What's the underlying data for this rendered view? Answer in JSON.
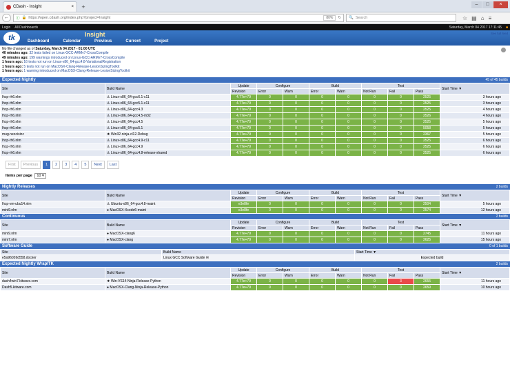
{
  "browser": {
    "tab_title": "CDash - Insight",
    "new_tab": "+",
    "url": "https://open.cdash.org/index.php?project=Insight",
    "zoom": "80%",
    "search_placeholder": "Search"
  },
  "topbar": {
    "login": "Login",
    "all": "All Dashboards",
    "date": "Saturday, March 04 2017 17:11:45"
  },
  "header": {
    "logo": "tk",
    "project": "Insight",
    "menu": [
      "Dashboard",
      "Calendar",
      "Previous",
      "Current",
      "Project"
    ]
  },
  "status": {
    "line0_prefix": "No file changed as of ",
    "line0_date": "Saturday, March 04 2017 - 01:00 UTC",
    "lines": [
      {
        "ago": "40 minutes ago:",
        "text": " 32 tests failed on Linux-GCC-ARMv7-CrossCompile"
      },
      {
        "ago": "49 minutes ago:",
        "text": " 199 warnings introduced on Linux-GCC-ARMv7-CrossCompile"
      },
      {
        "ago": "1 hours ago:",
        "text": " 16 tests not run on Linux-x86_64-gcc4.8-VariationalRegistration"
      },
      {
        "ago": "1 hours ago:",
        "text": " 5 tests not run on MacOSX-Clang-Release-LesionSizingToolkit"
      },
      {
        "ago": "1 hours ago:",
        "text": " 1 warning introduced on MacOSX-Clang-Release-LesionSizingToolkit"
      }
    ],
    "see_full": "See full feed"
  },
  "headers": {
    "site": "Site",
    "build": "Build Name",
    "update": "Update",
    "revision": "Revision",
    "configure": "Configure",
    "build_grp": "Build",
    "test": "Test",
    "error": "Error",
    "warn": "Warn",
    "notrun": "Not Run",
    "fail": "Fail",
    "pass": "Pass",
    "start": "Start Time ▼"
  },
  "expected": {
    "title": "Expected Nightly",
    "count": "45 of 45 builds",
    "rows": [
      {
        "site": "lhcp-rh6.nlm",
        "build": "Linux-x86_64-gcc6.1-c11",
        "rev": "4.77e+79",
        "ce": "0",
        "cw": "0",
        "be": "0",
        "bw": "0",
        "nr": "0",
        "f": "0",
        "p": "2525",
        "t": "3 hours ago"
      },
      {
        "site": "lhcp-rh6.nlm",
        "build": "Linux-x86_64-gcc5.1-c11",
        "rev": "4.77e+79",
        "ce": "0",
        "cw": "0",
        "be": "0",
        "bw": "0",
        "nr": "0",
        "f": "0",
        "p": "2525",
        "t": "3 hours ago"
      },
      {
        "site": "lhcp-rh6.nlm",
        "build": "Linux-x86_64-gcc4.3",
        "rev": "4.77e+79",
        "ce": "0",
        "cw": "0",
        "be": "0",
        "bw": "0",
        "nr": "0",
        "f": "0",
        "p": "2525",
        "t": "4 hours ago"
      },
      {
        "site": "lhcp-rh6.nlm",
        "build": "Linux-x86_64-gcc4.5-m32",
        "rev": "4.77e+79",
        "ce": "0",
        "cw": "0",
        "be": "0",
        "bw": "0",
        "nr": "0",
        "f": "0",
        "p": "2526",
        "t": "4 hours ago"
      },
      {
        "site": "lhcp-rh6.nlm",
        "build": "Linux-x86_64-gcc4.5",
        "rev": "4.77e+79",
        "ce": "0",
        "cw": "0",
        "be": "0",
        "bw": "0",
        "nr": "0",
        "f": "0",
        "p": "2525",
        "t": "5 hours ago"
      },
      {
        "site": "lhcp-rh6.nlm",
        "build": "Linux-x86_64-gcc5.1",
        "rev": "4.77e+79",
        "ce": "0",
        "cw": "0",
        "be": "0",
        "bw": "0",
        "nr": "0",
        "f": "0",
        "p": "5058",
        "t": "5 hours ago"
      },
      {
        "site": "mug.neocisinc",
        "build": "Win32-ninja-cl12-Debug",
        "rev": "4.77e+79",
        "ce": "0",
        "cw": "0",
        "be": "0",
        "bw": "0",
        "nr": "0",
        "f": "0",
        "p": "2367",
        "t": "5 hours ago"
      },
      {
        "site": "lhcp-rh6.nlm",
        "build": "Linux-x86_64-gcc4.9-c11",
        "rev": "4.77e+79",
        "ce": "0",
        "cw": "0",
        "be": "0",
        "bw": "0",
        "nr": "0",
        "f": "0",
        "p": "2525",
        "t": "6 hours ago"
      },
      {
        "site": "lhcp-rh6.nlm",
        "build": "Linux-x86_64-gcc4.9",
        "rev": "4.77e+79",
        "ce": "0",
        "cw": "0",
        "be": "0",
        "bw": "0",
        "nr": "0",
        "f": "0",
        "p": "2525",
        "t": "6 hours ago"
      },
      {
        "site": "lhcp-rh6.nlm",
        "build": "Linux-x86_64-gcc4.8-release-shared",
        "rev": "4.77e+79",
        "ce": "0",
        "cw": "0",
        "be": "0",
        "bw": "0",
        "nr": "0",
        "f": "0",
        "p": "2525",
        "t": "6 hours ago"
      }
    ]
  },
  "pager": {
    "first": "First",
    "prev": "Previous",
    "pages": [
      "1",
      "2",
      "3",
      "4",
      "5"
    ],
    "next": "Next",
    "last": "Last",
    "ipp_label": "Items per page",
    "ipp_value": "10 ▾"
  },
  "releases": {
    "title": "Nightly Releases",
    "count": "2 builds",
    "rows": [
      {
        "site": "lhcp-vm-ubu14.nlm",
        "build": "Ubuntu-x86_64-gcc4.8-maint",
        "rev": "e3e8fe",
        "ce": "0",
        "cw": "0",
        "be": "0",
        "bw": "0",
        "nr": "0",
        "f": "0",
        "p": "2504",
        "t": "5 hours ago"
      },
      {
        "site": "mini9.nlm",
        "build": "MacOSX-Xcode6-maint",
        "rev": "e3e8fe",
        "ce": "0",
        "cw": "0",
        "be": "0",
        "bw": "0",
        "nr": "0",
        "f": "0",
        "p": "2574",
        "t": "12 hours ago"
      }
    ]
  },
  "continuous": {
    "title": "Continuous",
    "count": "2 builds",
    "rows": [
      {
        "site": "mini9.nlm",
        "build": "MacOSX-clang6",
        "rev": "4.77e+79",
        "ce": "0",
        "cw": "0",
        "be": "0",
        "bw": "0",
        "nr": "0",
        "f": "0",
        "p": "2745",
        "t": "11 hours ago"
      },
      {
        "site": "mini7.nlm",
        "build": "MacOSX-clang",
        "rev": "4.77e+79",
        "ce": "0",
        "cw": "0",
        "be": "0",
        "bw": "0",
        "nr": "0",
        "f": "0",
        "p": "2625",
        "t": "15 hours ago"
      }
    ]
  },
  "guide": {
    "title": "Software Guide",
    "count": "0 of 1 builds",
    "site": "e5a96026d558.docker",
    "build": "Linux GCC Software Guide",
    "expected": "Expected build"
  },
  "wrapitk": {
    "title": "Expected Nightly WrapITK",
    "count": "2 builds",
    "rows": [
      {
        "site": "dash4win7.kitware.com",
        "build": "Win-VS14-Ninja-Release-Python",
        "rev": "4.77e+79",
        "ce": "0",
        "cw": "0",
        "be": "0",
        "bw": "0",
        "nr": "0",
        "f": "3",
        "p": "2655",
        "t": "11 hours ago"
      },
      {
        "site": "Dash5.kitware.com",
        "build": "MacOSX-Clang-Ninja-Release-Python",
        "rev": "4.77e+79",
        "ce": "0",
        "cw": "0",
        "be": "0",
        "bw": "0",
        "nr": "0",
        "f": "0",
        "p": "2659",
        "t": "10 hours ago"
      }
    ]
  }
}
